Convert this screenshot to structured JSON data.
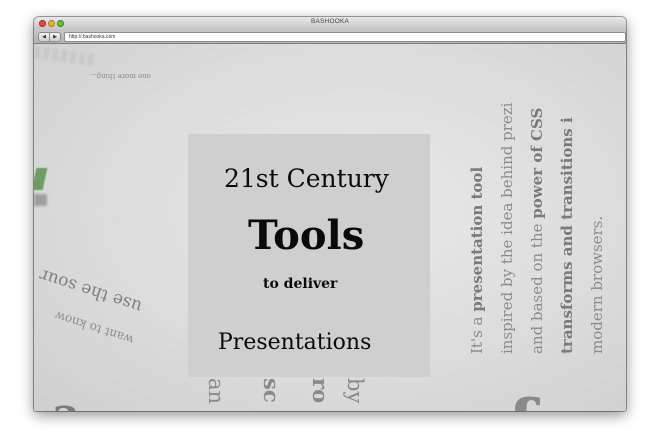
{
  "window": {
    "title": "BASHOOKA"
  },
  "toolbar": {
    "back_label": "◀",
    "forward_label": "▶",
    "url": "http://.bashooka.com"
  },
  "hero": {
    "line1": "21st Century",
    "line2": "Tools",
    "line3": "to deliver",
    "line4": "Presentations"
  },
  "background": {
    "one_more": "one more thing...",
    "sour": "use the sour",
    "want": "want to know",
    "bottom_letters": [
      "an",
      "sc",
      "ro",
      "by"
    ],
    "bottom_big": "a",
    "css_partial": "ofcss",
    "vertical": {
      "l1_pre": "It's a ",
      "l1_bold": "presentation tool",
      "l2": "inspired by the idea behind prezi",
      "l3_pre": "and based on the ",
      "l3_bold": "power of CSS",
      "l4_bold": "transforms and transitions i",
      "l5": "modern browsers."
    }
  },
  "colors": {
    "close": "#e24b41",
    "minimize": "#e6b431",
    "maximize": "#6dbf3c",
    "accent_green": "#4a8a3a"
  }
}
